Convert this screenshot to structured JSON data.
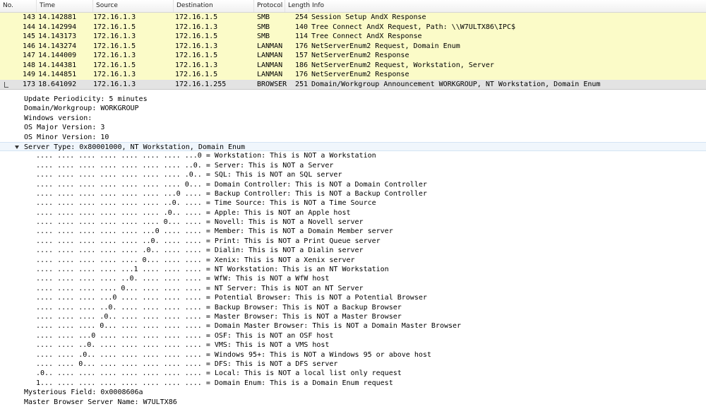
{
  "columns": {
    "no": "No.",
    "time": "Time",
    "source": "Source",
    "destination": "Destination",
    "protocol": "Protocol",
    "length": "Length",
    "info": "Info"
  },
  "packets": [
    {
      "no": "143",
      "time": "14.142881",
      "src": "172.16.1.3",
      "dst": "172.16.1.5",
      "proto": "SMB",
      "len": "254",
      "info": "Session Setup AndX Response"
    },
    {
      "no": "144",
      "time": "14.142994",
      "src": "172.16.1.5",
      "dst": "172.16.1.3",
      "proto": "SMB",
      "len": "140",
      "info": "Tree Connect AndX Request, Path: \\\\W7ULTX86\\IPC$"
    },
    {
      "no": "145",
      "time": "14.143173",
      "src": "172.16.1.3",
      "dst": "172.16.1.5",
      "proto": "SMB",
      "len": "114",
      "info": "Tree Connect AndX Response"
    },
    {
      "no": "146",
      "time": "14.143274",
      "src": "172.16.1.5",
      "dst": "172.16.1.3",
      "proto": "LANMAN",
      "len": "176",
      "info": "NetServerEnum2 Request, Domain Enum"
    },
    {
      "no": "147",
      "time": "14.144009",
      "src": "172.16.1.3",
      "dst": "172.16.1.5",
      "proto": "LANMAN",
      "len": "157",
      "info": "NetServerEnum2 Response"
    },
    {
      "no": "148",
      "time": "14.144381",
      "src": "172.16.1.5",
      "dst": "172.16.1.3",
      "proto": "LANMAN",
      "len": "186",
      "info": "NetServerEnum2 Request, Workstation, Server"
    },
    {
      "no": "149",
      "time": "14.144851",
      "src": "172.16.1.3",
      "dst": "172.16.1.5",
      "proto": "LANMAN",
      "len": "176",
      "info": "NetServerEnum2 Response"
    },
    {
      "no": "173",
      "time": "18.641092",
      "src": "172.16.1.3",
      "dst": "172.16.1.255",
      "proto": "BROWSER",
      "len": "251",
      "info": "Domain/Workgroup Announcement WORKGROUP, NT Workstation, Domain Enum"
    }
  ],
  "details": [
    "Update Periodicity: 5 minutes",
    "Domain/Workgroup: WORKGROUP",
    "Windows version:",
    "OS Major Version: 3",
    "OS Minor Version: 10",
    "Server Type: 0x80001000, NT Workstation, Domain Enum"
  ],
  "flags": [
    ".... .... .... .... .... .... .... ...0 = Workstation: This is NOT a Workstation",
    ".... .... .... .... .... .... .... ..0. = Server: This is NOT a Server",
    ".... .... .... .... .... .... .... .0.. = SQL: This is NOT an SQL server",
    ".... .... .... .... .... .... .... 0... = Domain Controller: This is NOT a Domain Controller",
    ".... .... .... .... .... .... ...0 .... = Backup Controller: This is NOT a Backup Controller",
    ".... .... .... .... .... .... ..0. .... = Time Source: This is NOT a Time Source",
    ".... .... .... .... .... .... .0.. .... = Apple: This is NOT an Apple host",
    ".... .... .... .... .... .... 0... .... = Novell: This is NOT a Novell server",
    ".... .... .... .... .... ...0 .... .... = Member: This is NOT a Domain Member server",
    ".... .... .... .... .... ..0. .... .... = Print: This is NOT a Print Queue server",
    ".... .... .... .... .... .0.. .... .... = Dialin: This is NOT a Dialin server",
    ".... .... .... .... .... 0... .... .... = Xenix: This is NOT a Xenix server",
    ".... .... .... .... ...1 .... .... .... = NT Workstation: This is an NT Workstation",
    ".... .... .... .... ..0. .... .... .... = WfW: This is NOT a WfW host",
    ".... .... .... .... 0... .... .... .... = NT Server: This is NOT an NT Server",
    ".... .... .... ...0 .... .... .... .... = Potential Browser: This is NOT a Potential Browser",
    ".... .... .... ..0. .... .... .... .... = Backup Browser: This is NOT a Backup Browser",
    ".... .... .... .0.. .... .... .... .... = Master Browser: This is NOT a Master Browser",
    ".... .... .... 0... .... .... .... .... = Domain Master Browser: This is NOT a Domain Master Browser",
    ".... .... ...0 .... .... .... .... .... = OSF: This is NOT an OSF host",
    ".... .... ..0. .... .... .... .... .... = VMS: This is NOT a VMS host",
    ".... .... .0.. .... .... .... .... .... = Windows 95+: This is NOT a Windows 95 or above host",
    ".... .... 0... .... .... .... .... .... = DFS: This is NOT a DFS server",
    ".0.. .... .... .... .... .... .... .... = Local: This is NOT a local list only request",
    "1... .... .... .... .... .... .... .... = Domain Enum: This is a Domain Enum request"
  ],
  "trailer": [
    "Mysterious Field: 0x0008606a",
    "Master Browser Server Name: W7ULTX86"
  ]
}
